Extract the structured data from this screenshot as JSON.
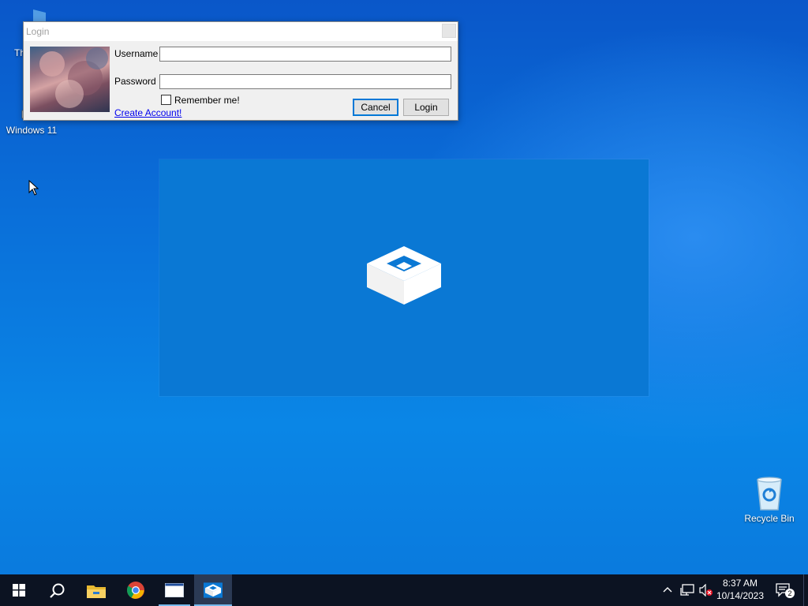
{
  "desktop": {
    "icons": [
      {
        "label": "Th"
      },
      {
        "label": "Windows 11"
      },
      {
        "label": "Recycle Bin"
      }
    ]
  },
  "login_dialog": {
    "title": "Login",
    "username_label": "Username",
    "username_value": "",
    "password_label": "Password",
    "password_value": "",
    "remember_label": "Remember me!",
    "remember_checked": false,
    "create_account_link": "Create Account!",
    "cancel_label": "Cancel",
    "login_label": "Login"
  },
  "taskbar": {
    "apps": [
      "start-icon",
      "search-icon",
      "file-explorer-icon",
      "chrome-icon",
      "window-app-icon",
      "sandbox-app-icon"
    ],
    "active_app": "sandbox-app-icon",
    "tray_icons": [
      "chevron-up-icon",
      "network-icon",
      "volume-muted-icon"
    ],
    "clock": {
      "time": "8:37 AM",
      "date": "10/14/2023"
    },
    "notification_count": "2"
  },
  "colors": {
    "desktop_accent": "#0a78d4",
    "taskbar": "#0c1322",
    "focus_border": "#0078d7"
  }
}
